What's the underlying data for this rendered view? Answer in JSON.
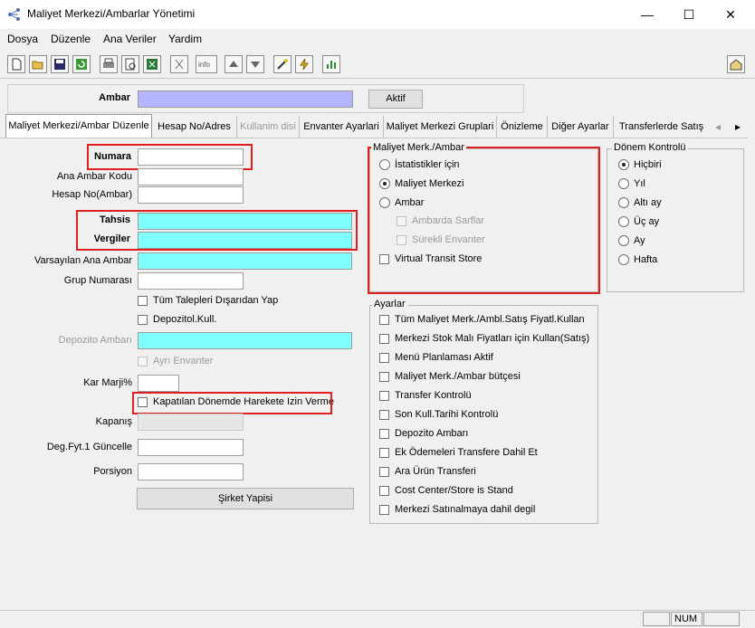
{
  "window": {
    "title": "Maliyet Merkezi/Ambarlar Yönetimi",
    "min": "—",
    "max": "☐",
    "close": "✕"
  },
  "menu": [
    "Dosya",
    "Düzenle",
    "Ana Veriler",
    "Yardim"
  ],
  "ambar": {
    "label": "Ambar",
    "value": "",
    "button": "Aktif"
  },
  "tabs": [
    "Maliyet Merkezi/Ambar Düzenle",
    "Hesap No/Adres",
    "Kullanim disi",
    "Envanter Ayarlari",
    "Maliyet Merkezi Gruplari",
    "Önizleme",
    "Diğer Ayarlar",
    "Transferlerde Satış Fi"
  ],
  "tab_scroll": {
    "left": "◂",
    "right": "▸"
  },
  "form": {
    "numara": "Numara",
    "ana_ambar_kodu": "Ana Ambar Kodu",
    "hesap_no": "Hesap No(Ambar)",
    "tahsis": "Tahsis",
    "vergiler": "Vergiler",
    "varsayilan_ana_ambar": "Varsayılan Ana Ambar",
    "grup_numarasi": "Grup Numarası",
    "tum_talepleri": "Tüm Talepleri Dışarıdan Yap",
    "depozitol_kull": "Depozitol.Kull.",
    "depozito_ambari": "Depozito Ambarı",
    "ayri_envanter": "Ayrı Envanter",
    "kar_marji": "Kar Marji%",
    "kapatilan_donemde": "Kapatılan Dönemde Harekete Izin Verme",
    "kapanis": "Kapanış",
    "deg_fyt": "Deg.Fyt.1 Güncelle",
    "porsiyon": "Porsiyon",
    "sirket_yapisi": "Şirket Yapisi"
  },
  "maliyet_group": {
    "title": "Maliyet Merk./Ambar",
    "options": [
      "İstatistikler için",
      "Maliyet Merkezi",
      "Ambar"
    ],
    "selected": "Maliyet Merkezi",
    "sub": [
      "Ambarda Sarflar",
      "Sürekli Envanter"
    ],
    "virtual": "Virtual Transit Store"
  },
  "donem_group": {
    "title": "Dönem Kontrolü",
    "options": [
      "Hiçbiri",
      "Yıl",
      "Altı ay",
      "Üç ay",
      "Ay",
      "Hafta"
    ],
    "selected": "Hiçbiri"
  },
  "ayarlar_group": {
    "title": "Ayarlar",
    "items": [
      "Tüm Maliyet Merk./Ambl.Satış Fiyatl.Kullan",
      "Merkezi Stok Malı Fiyatları için Kullan(Satış)",
      "Menü Planlaması Aktif",
      "Maliyet Merk./Ambar bütçesi",
      "Transfer Kontrolü",
      "Son Kull.Tarihi Kontrolü",
      "Depozito Ambarı",
      "Ek Ödemeleri Transfere Dahil Et",
      "Ara Ürün Transferi",
      "Cost Center/Store is Stand",
      "Merkezi Satınalmaya dahil degil"
    ]
  },
  "status": {
    "num": "NUM"
  },
  "colors": {
    "cyan_field": "#80ffff",
    "lavender_field": "#b4b4ff",
    "highlight": "#e02020"
  }
}
